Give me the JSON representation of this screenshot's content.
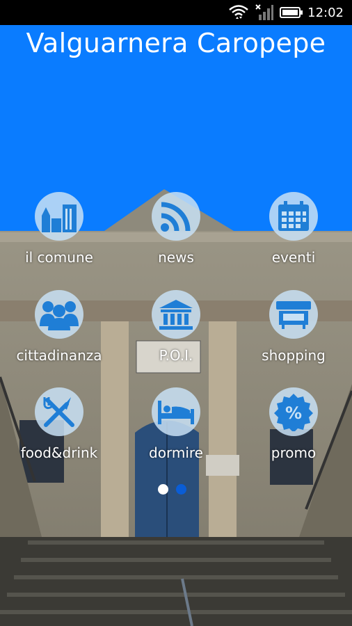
{
  "status": {
    "time": "12:02"
  },
  "app": {
    "title": "Valguarnera Caropepe"
  },
  "menu": [
    {
      "label": "il comune",
      "icon": "town-icon"
    },
    {
      "label": "news",
      "icon": "rss-icon"
    },
    {
      "label": "eventi",
      "icon": "calendar-icon"
    },
    {
      "label": "cittadinanza",
      "icon": "people-icon"
    },
    {
      "label": "P.O.I.",
      "icon": "museum-icon"
    },
    {
      "label": "shopping",
      "icon": "shop-icon"
    },
    {
      "label": "food&drink",
      "icon": "fork-knife-icon"
    },
    {
      "label": "dormire",
      "icon": "bed-icon"
    },
    {
      "label": "promo",
      "icon": "percent-badge-icon"
    }
  ],
  "pager": {
    "pages": 2,
    "active": 2
  },
  "colors": {
    "header": "#0a7cff",
    "icon": "#1f7ed6",
    "circle": "#c8e1f5"
  }
}
